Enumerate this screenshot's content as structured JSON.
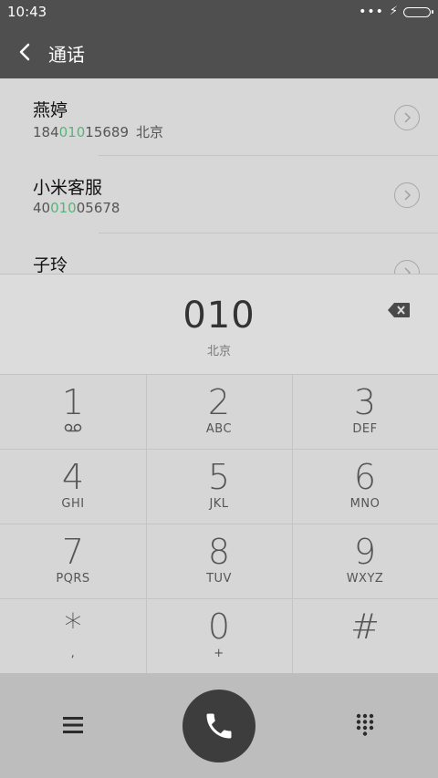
{
  "status": {
    "time": "10:43",
    "dots": "•••",
    "bolt": "⚡"
  },
  "header": {
    "title": "通话"
  },
  "contacts": [
    {
      "name": "燕婷",
      "num_pre": "184",
      "num_hl": "010",
      "num_post": "15689",
      "location": "北京"
    },
    {
      "name": "小米客服",
      "num_pre": "40",
      "num_hl": "010",
      "num_post": "05678",
      "location": ""
    },
    {
      "name": "子玲"
    }
  ],
  "dialer": {
    "digits": "010",
    "region": "北京"
  },
  "keys": [
    {
      "main": "1",
      "sub": ""
    },
    {
      "main": "2",
      "sub": "ABC"
    },
    {
      "main": "3",
      "sub": "DEF"
    },
    {
      "main": "4",
      "sub": "GHI"
    },
    {
      "main": "5",
      "sub": "JKL"
    },
    {
      "main": "6",
      "sub": "MNO"
    },
    {
      "main": "7",
      "sub": "PQRS"
    },
    {
      "main": "8",
      "sub": "TUV"
    },
    {
      "main": "9",
      "sub": "WXYZ"
    },
    {
      "main": "*",
      "sub": ","
    },
    {
      "main": "0",
      "sub": "+"
    },
    {
      "main": "#",
      "sub": ""
    }
  ],
  "colors": {
    "highlight": "#5ab37a",
    "bar": "#4f4f4f",
    "call": "#3d3d3d"
  }
}
